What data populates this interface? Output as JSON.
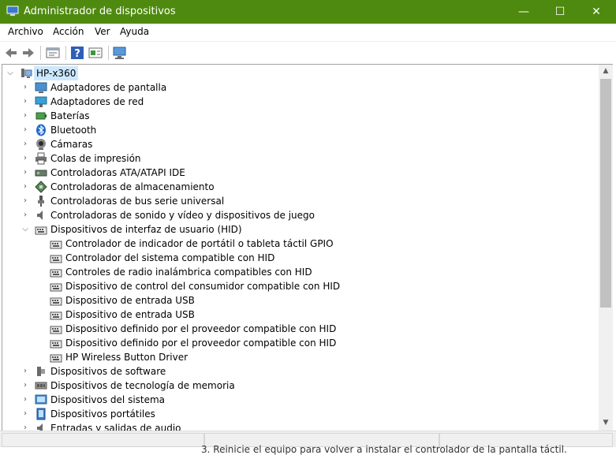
{
  "window": {
    "title": "Administrador de dispositivos",
    "minimize": "—",
    "maximize": "☐",
    "close": "✕",
    "title_bar_color": "#4f8a10"
  },
  "menu": [
    "Archivo",
    "Acción",
    "Ver",
    "Ayuda"
  ],
  "toolbar": {
    "buttons": [
      "back-arrow-icon",
      "forward-arrow-icon",
      "properties-icon",
      "help-icon",
      "update-driver-icon",
      "scan-hardware-icon"
    ]
  },
  "tree": {
    "root": "HP-x360",
    "categories": [
      {
        "label": "Adaptadores de pantalla",
        "icon": "display-adapter-icon"
      },
      {
        "label": "Adaptadores de red",
        "icon": "network-adapter-icon"
      },
      {
        "label": "Baterías",
        "icon": "battery-icon"
      },
      {
        "label": "Bluetooth",
        "icon": "bluetooth-icon"
      },
      {
        "label": "Cámaras",
        "icon": "camera-icon"
      },
      {
        "label": "Colas de impresión",
        "icon": "printer-icon"
      },
      {
        "label": "Controladoras ATA/ATAPI IDE",
        "icon": "ide-controller-icon"
      },
      {
        "label": "Controladoras de almacenamiento",
        "icon": "storage-controller-icon"
      },
      {
        "label": "Controladoras de bus serie universal",
        "icon": "usb-icon"
      },
      {
        "label": "Controladoras de sonido y vídeo y dispositivos de juego",
        "icon": "speaker-icon"
      },
      {
        "label": "Dispositivos de interfaz de usuario (HID)",
        "icon": "hid-icon",
        "expanded": true
      }
    ],
    "hid_children": [
      "Controlador de indicador de portátil o tableta táctil GPIO",
      "Controlador del sistema compatible con HID",
      "Controles de radio inalámbrica compatibles con HID",
      "Dispositivo de control del consumidor compatible con HID",
      "Dispositivo de entrada USB",
      "Dispositivo de entrada USB",
      "Dispositivo definido por el proveedor compatible con HID",
      "Dispositivo definido por el proveedor compatible con HID",
      "HP Wireless Button Driver"
    ],
    "categories_after": [
      {
        "label": "Dispositivos de software",
        "icon": "software-device-icon"
      },
      {
        "label": "Dispositivos de tecnología de memoria",
        "icon": "memory-icon"
      },
      {
        "label": "Dispositivos del sistema",
        "icon": "system-device-icon"
      },
      {
        "label": "Dispositivos portátiles",
        "icon": "portable-device-icon"
      },
      {
        "label": "Entradas y salidas de audio",
        "icon": "audio-io-icon"
      }
    ]
  },
  "background_text": "3. Reinicie el equipo para volver a instalar el controlador de la pantalla táctil."
}
